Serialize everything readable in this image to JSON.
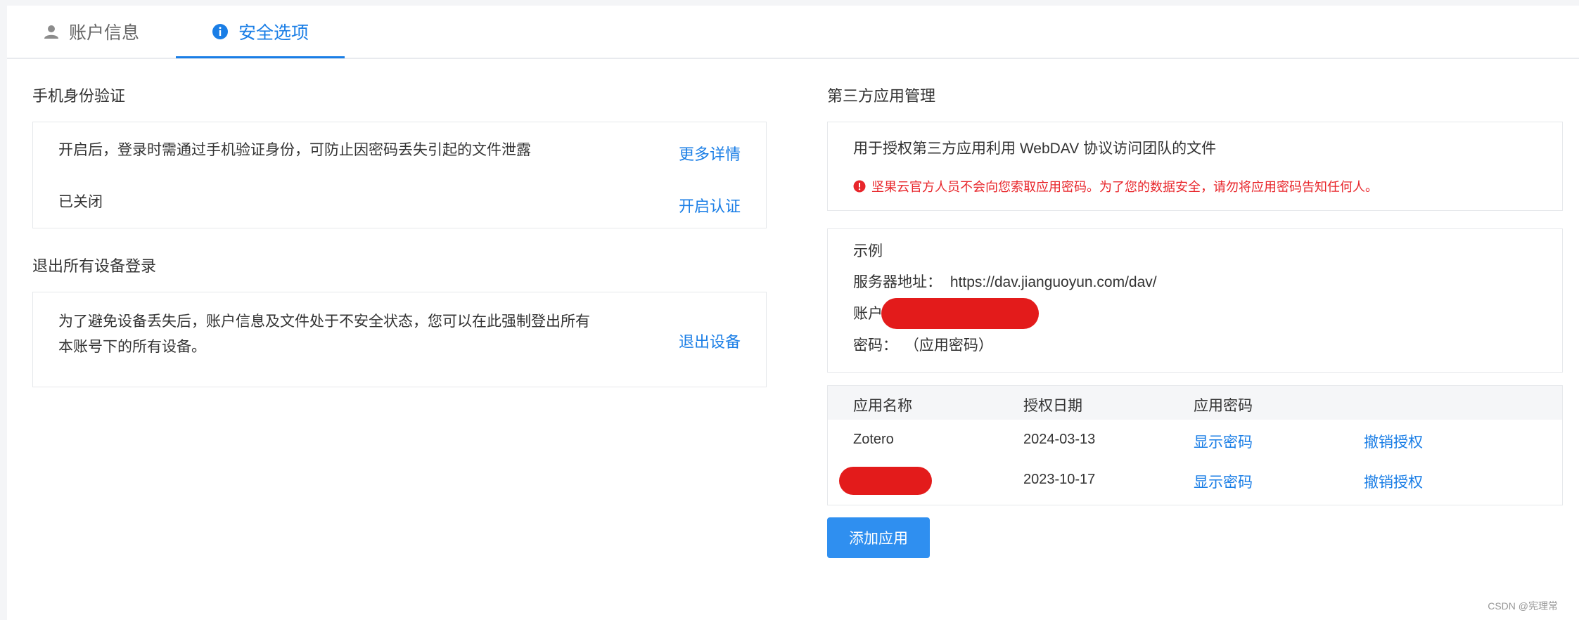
{
  "tabs": [
    {
      "label": "账户信息"
    },
    {
      "label": "安全选项"
    }
  ],
  "phone_verify": {
    "title": "手机身份验证",
    "description": "开启后，登录时需通过手机验证身份，可防止因密码丢失引起的文件泄露",
    "more_link": "更多详情",
    "status": "已关闭",
    "enable_link": "开启认证"
  },
  "logout_all": {
    "title": "退出所有设备登录",
    "description_line1": "为了避免设备丢失后，账户信息及文件处于不安全状态，您可以在此强制登出所有",
    "description_line2": "本账号下的所有设备。",
    "logout_link": "退出设备"
  },
  "third_party": {
    "title": "第三方应用管理",
    "description": "用于授权第三方应用利用 WebDAV 协议访问团队的文件",
    "warning": "坚果云官方人员不会向您索取应用密码。为了您的数据安全，请勿将应用密码告知任何人。",
    "example": {
      "heading": "示例",
      "server_label": "服务器地址：",
      "server_value": "https://dav.jianguoyun.com/dav/",
      "account_label": "账户",
      "password_label": "密码：",
      "password_value": "（应用密码）"
    },
    "table": {
      "headers": [
        "应用名称",
        "授权日期",
        "应用密码"
      ],
      "rows": [
        {
          "name": "Zotero",
          "date": "2024-03-13",
          "show": "显示密码",
          "revoke": "撤销授权"
        },
        {
          "name": "",
          "date": "2023-10-17",
          "show": "显示密码",
          "revoke": "撤销授权"
        }
      ]
    },
    "add_button": "添加应用"
  },
  "watermark": "CSDN @宪理常",
  "colors": {
    "accent": "#1a7ee6",
    "button": "#2f8ff0",
    "warning": "#e8262b",
    "redaction": "#e31b1b"
  }
}
